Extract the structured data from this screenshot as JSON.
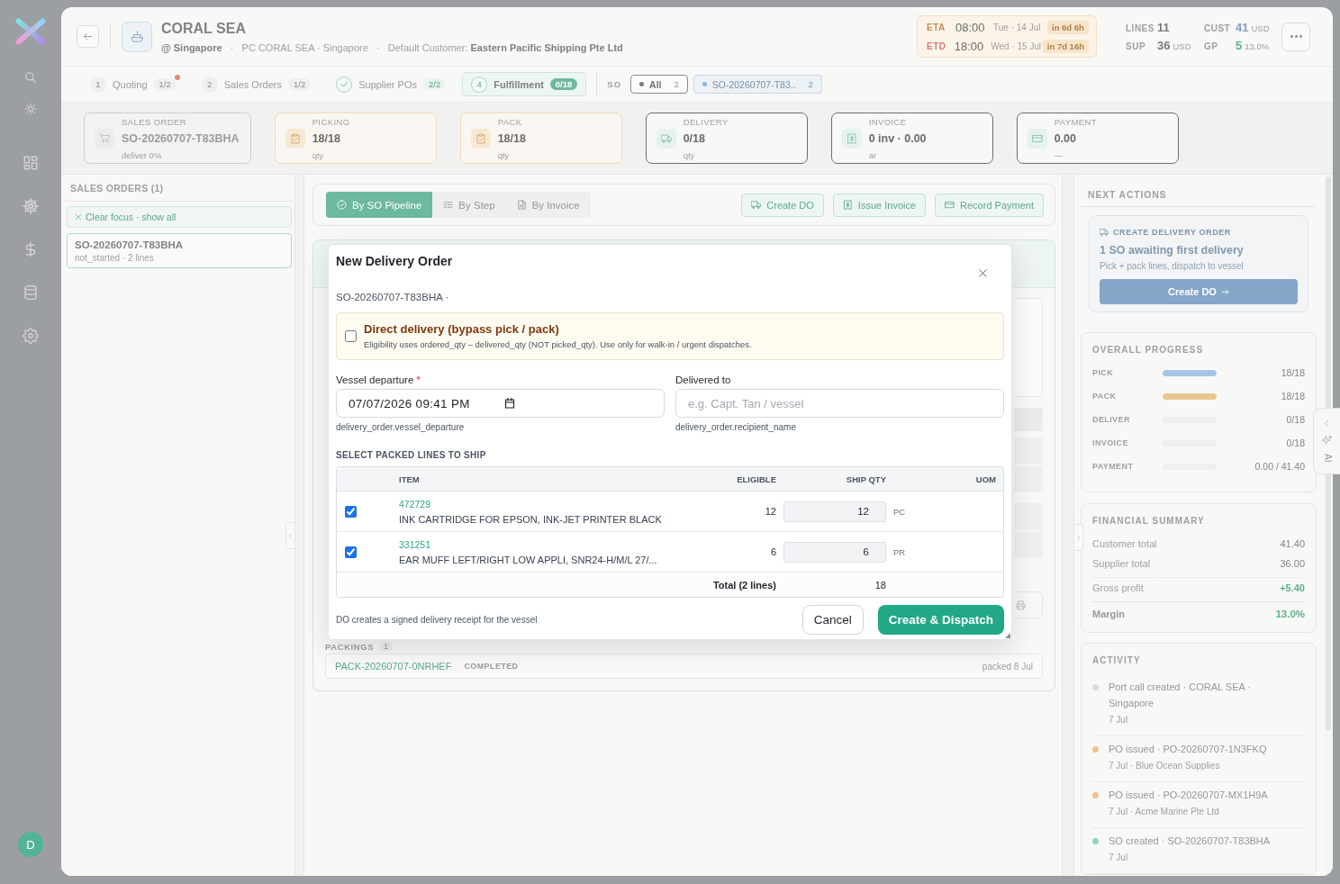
{
  "sidebar": {
    "avatar": "D"
  },
  "header": {
    "title": "CORAL SEA",
    "subtitle": "**@ Singapore**   ·   PC CORAL SEA · Singapore   ·   Default Customer: **Eastern Pacific Shipping Pte Ltd**",
    "schedule": [
      {
        "kind": "arrival",
        "label": "ETA",
        "time": "08:00",
        "date": "Tue · 14 Jul",
        "countdown": "in 6d 6h"
      },
      {
        "kind": "departure",
        "label": "ETD",
        "time": "18:00",
        "date": "Wed · 15 Jul",
        "countdown": "in 7d 16h"
      }
    ],
    "stats": [
      {
        "label": "LINES",
        "value": "11",
        "color": "#7a7a7a"
      },
      {
        "label": "CUST",
        "value": "41",
        "unit": "USD",
        "color": "#7f9fc0"
      },
      {
        "label": "SUP",
        "value": "36",
        "unit": "USD",
        "color": "#7a7a7a"
      },
      {
        "label": "GP",
        "value": "5",
        "unit": "13.0%",
        "color": "#5fb088"
      }
    ]
  },
  "steps": [
    {
      "number": "1",
      "label": "Quoting",
      "count": "1/2",
      "complete": false,
      "alert": true,
      "selected": false
    },
    {
      "number": "2",
      "label": "Sales Orders",
      "count": "1/2",
      "complete": false,
      "alert": false,
      "selected": false
    },
    {
      "label": "Supplier POs",
      "count": "2/2",
      "complete": true,
      "alert": false,
      "selected": false
    },
    {
      "number": "4",
      "label": "Fulfillment",
      "count": "0/18",
      "complete": false,
      "alert": false,
      "selected": true
    }
  ],
  "so_filter": {
    "label": "SO",
    "chips": [
      {
        "label": "All",
        "count": "2",
        "color": "#7a7a7a",
        "selected": true
      },
      {
        "label": "SO-20260707-T83..",
        "count": "2",
        "color": "#8db4de",
        "selected": false
      }
    ]
  },
  "stages": [
    {
      "label": "SALES ORDER",
      "value": "SO-20260707-T83BHA",
      "sub": "deliver 0%",
      "disabled": true,
      "complete": false
    },
    {
      "label": "PICKING",
      "value": "18/18",
      "sub": "qty",
      "disabled": false,
      "complete": true
    },
    {
      "label": "PACK",
      "value": "18/18",
      "sub": "qty",
      "disabled": false,
      "complete": true
    },
    {
      "label": "DELIVERY",
      "value": "0/18",
      "sub": "qty",
      "disabled": false,
      "complete": false
    },
    {
      "label": "INVOICE",
      "value": "0 inv · 0.00",
      "sub": "ar",
      "disabled": false,
      "complete": false
    },
    {
      "label": "PAYMENT",
      "value": "0.00",
      "sub": "—",
      "disabled": false,
      "complete": false
    }
  ],
  "sales_orders": {
    "title": "SALES ORDERS (1)",
    "clear_focus": "Clear focus · show all",
    "items": [
      {
        "id": "SO-20260707-T83BHA",
        "meta": "not_started · 2 lines",
        "selected": true
      }
    ]
  },
  "views": [
    {
      "label": "By SO Pipeline",
      "selected": true
    },
    {
      "label": "By Step",
      "selected": false
    },
    {
      "label": "By Invoice",
      "selected": false
    }
  ],
  "actions": [
    "Create DO",
    "Issue Invoice",
    "Record Payment"
  ],
  "packings": {
    "label": "PACKINGS",
    "count": "1",
    "rows": [
      {
        "id": "PACK-20260707-0NRHEF",
        "status": "COMPLETED",
        "date": "packed 8 Jul"
      }
    ]
  },
  "dialog": {
    "title": "New Delivery Order",
    "subtitle": "SO-20260707-T83BHA ·",
    "direct_delivery": {
      "label": "Direct delivery (bypass pick / pack)",
      "note": "Eligibility uses ordered_qty – delivered_qty (NOT picked_qty). Use only for walk-in / urgent dispatches.",
      "checked": false
    },
    "fields": [
      {
        "kind": "datetime",
        "label": "Vessel departure",
        "required_mark": "*",
        "value": "07/07/2026 09:41 PM",
        "hint": "delivery_order.vessel_departure"
      },
      {
        "kind": "text",
        "label": "Delivered to",
        "placeholder": "e.g. Capt. Tan / vessel",
        "hint": "delivery_order.recipient_name"
      }
    ],
    "lines_title": "SELECT PACKED LINES TO SHIP",
    "table": {
      "columns": [
        "ITEM",
        "ELIGIBLE",
        "SHIP QTY",
        "UOM"
      ],
      "rows": [
        {
          "checked": true,
          "code": "472729",
          "name": "INK CARTRIDGE FOR EPSON, INK-JET PRINTER BLACK",
          "eligible": "12",
          "ship_qty": "12",
          "uom": "PC"
        },
        {
          "checked": true,
          "code": "331251",
          "name": "EAR MUFF LEFT/RIGHT LOW APPLI, SNR24-H/M/L 27/...",
          "eligible": "6",
          "ship_qty": "6",
          "uom": "PR"
        }
      ],
      "total_label": "Total (2 lines)",
      "total": "18"
    },
    "footer_note": "DO creates a signed delivery receipt for the vessel",
    "buttons": [
      {
        "kind": "cancel",
        "label": "Cancel"
      },
      {
        "kind": "submit",
        "label": "Create & Dispatch"
      }
    ]
  },
  "next_actions": {
    "title": "NEXT ACTIONS",
    "eyebrow": "CREATE DELIVERY ORDER",
    "headline": "1 SO awaiting first delivery",
    "note": "Pick + pack lines, dispatch to vessel",
    "button": "Create DO"
  },
  "progress": {
    "title": "OVERALL PROGRESS",
    "rows": [
      {
        "label": "PICK",
        "level": 1,
        "color": "#a3c6e8",
        "reading": "18/18"
      },
      {
        "label": "PACK",
        "level": 1,
        "color": "#e9c692",
        "reading": "18/18"
      },
      {
        "label": "DELIVER",
        "level": 0,
        "reading": "0/18"
      },
      {
        "label": "INVOICE",
        "level": 0,
        "reading": "0/18"
      },
      {
        "label": "PAYMENT",
        "level": 0,
        "reading": "0.00 / 41.40"
      }
    ]
  },
  "financial": {
    "title": "FINANCIAL SUMMARY",
    "rows": [
      {
        "kind": "plain",
        "label": "Customer total",
        "value": "41.40"
      },
      {
        "kind": "plain",
        "label": "Supplier total",
        "value": "36.00"
      },
      {
        "kind": "positive",
        "label": "Gross profit",
        "value": "+5.40"
      },
      {
        "kind": "total",
        "label": "Margin",
        "value": "13.0%"
      }
    ]
  },
  "activity": {
    "title": "ACTIVITY",
    "items": [
      {
        "text": "Port call created · CORAL SEA · Singapore",
        "meta": "7 Jul",
        "color": "#d8dadd"
      },
      {
        "text": "PO issued · PO-20260707-1N3FKQ",
        "meta": "7 Jul · Blue Ocean Supplies",
        "color": "#eec48f"
      },
      {
        "text": "PO issued · PO-20260707-MX1H9A",
        "meta": "7 Jul · Acme Marine Pte Ltd",
        "color": "#eec48f"
      },
      {
        "text": "SO created · SO-20260707-T83BHA",
        "meta": "7 Jul",
        "color": "#92d4be"
      }
    ]
  },
  "ai_tab": {
    "label": "AI"
  }
}
